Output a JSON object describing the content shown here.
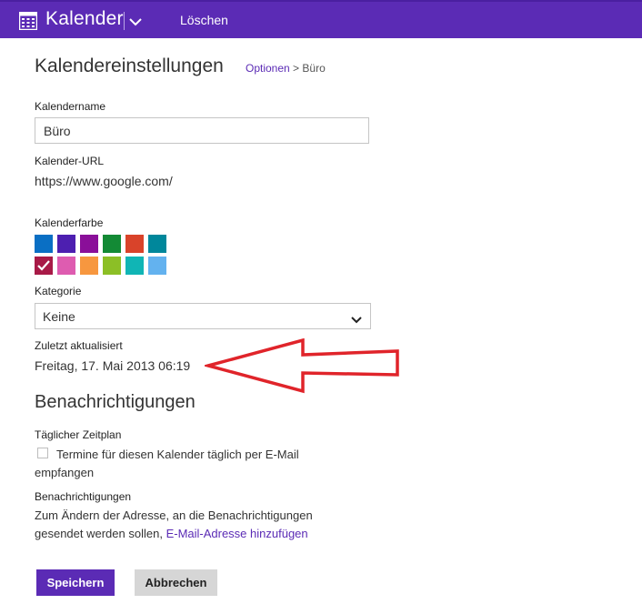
{
  "header": {
    "app_title": "Kalender",
    "delete_label": "Löschen",
    "color": "#5b2bb5"
  },
  "page": {
    "title": "Kalendereinstellungen",
    "breadcrumb_link": "Optionen",
    "breadcrumb_separator": ">",
    "breadcrumb_current": "Büro"
  },
  "calendar_name": {
    "label": "Kalendername",
    "value": "Büro"
  },
  "calendar_url": {
    "label": "Kalender-URL",
    "value": "https://www.google.com/"
  },
  "calendar_color": {
    "label": "Kalenderfarbe",
    "swatches": [
      {
        "color": "#0a6fc4",
        "selected": false
      },
      {
        "color": "#4d1fb0",
        "selected": false
      },
      {
        "color": "#8a0f99",
        "selected": false
      },
      {
        "color": "#138a35",
        "selected": false
      },
      {
        "color": "#d9432a",
        "selected": false
      },
      {
        "color": "#00879b",
        "selected": false
      },
      {
        "color": "#a81a47",
        "selected": true
      },
      {
        "color": "#de5cb0",
        "selected": false
      },
      {
        "color": "#f7973f",
        "selected": false
      },
      {
        "color": "#8cbf26",
        "selected": false
      },
      {
        "color": "#10b5b5",
        "selected": false
      },
      {
        "color": "#63b2ef",
        "selected": false
      }
    ]
  },
  "category": {
    "label": "Kategorie",
    "value": "Keine"
  },
  "last_updated": {
    "label": "Zuletzt aktualisiert",
    "value": "Freitag, 17. Mai 2013 06:19"
  },
  "notifications": {
    "section_title": "Benachrichtigungen",
    "daily_label": "Täglicher Zeitplan",
    "daily_checkbox_text": "Termine für diesen Kalender täglich per E-Mail empfangen",
    "daily_checked": false,
    "notify_label": "Benachrichtigungen",
    "notify_text": "Zum Ändern der Adresse, an die Benachrichtigungen gesendet werden sollen,",
    "notify_link": "E-Mail-Adresse hinzufügen"
  },
  "buttons": {
    "save_label": "Speichern",
    "cancel_label": "Abbrechen"
  },
  "annotation": {
    "arrow_color": "#e0242a"
  }
}
